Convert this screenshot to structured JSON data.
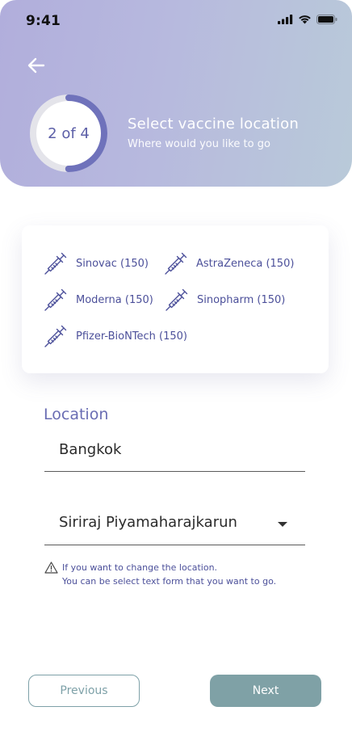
{
  "status": {
    "time": "9:41"
  },
  "header": {
    "progress_label": "2 of 4",
    "progress_fraction": 0.5,
    "title": "Select vaccine location",
    "subtitle": "Where would you like to go"
  },
  "vaccines": [
    {
      "label": "Sinovac (150)",
      "icon": "syringe-icon"
    },
    {
      "label": "AstraZeneca (150)",
      "icon": "syringe-icon"
    },
    {
      "label": "Moderna (150)",
      "icon": "syringe-icon"
    },
    {
      "label": "Sinopharm (150)",
      "icon": "syringe-icon"
    },
    {
      "label": "Pfizer-BioNTech (150)",
      "icon": "syringe-icon"
    }
  ],
  "location": {
    "label": "Location",
    "city": "Bangkok",
    "hospital": "Siriraj Piyamaharajkarun"
  },
  "note": {
    "line1": "If you want to change the location.",
    "line2": "You can be select text form that you want to go."
  },
  "buttons": {
    "previous": "Previous",
    "next": "Next"
  },
  "colors": {
    "accent": "#6a6db3",
    "primary_button": "#7fa1a6",
    "header_start": "#b1aedc",
    "header_end": "#b9cad9"
  }
}
